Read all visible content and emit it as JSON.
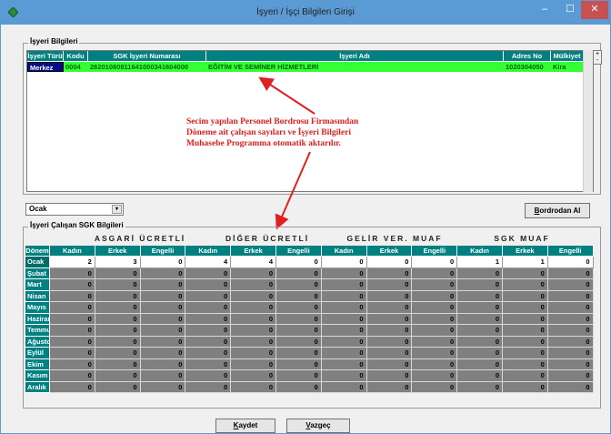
{
  "window": {
    "title": "İşyeri / İşçi Bilgileri Girişi",
    "minimize_label": "–",
    "maximize_label": "☐",
    "close_label": "✕"
  },
  "employer_group": {
    "label": "İşyeri Bilgileri",
    "columns": [
      "İşyeri Türü",
      "Kodu",
      "SGK İşyeri Numarası",
      "İşyeri Adı",
      "Adres No",
      "Mülkiyet"
    ],
    "row": {
      "type": "Merkez",
      "code": "0004",
      "sgk_no": "26201080811641000341604000",
      "name": "EĞİTİM VE SEMİNER HİZMETLERİ",
      "address_no": "1020304050",
      "ownership": "Kira"
    },
    "spin_up": "+",
    "spin_down": "-"
  },
  "annotation": {
    "line1": "Secim yapılan Personel Bordrosu Firmasından",
    "line2": "Döneme ait çalışan sayıları ve İşyeri Bilgileri",
    "line3": "Muhasebe Programma otomatik aktarılır."
  },
  "month_select": {
    "value": "Ocak",
    "arrow": "▾"
  },
  "bordrodan_button": {
    "first": "B",
    "rest": "ordrodan Al"
  },
  "sgk_group": {
    "label": "İşyeri Çalışan SGK Bilgileri",
    "categories": [
      "ASGARİ ÜCRETLİ",
      "DİĞER ÜCRETLİ",
      "GELİR VER. MUAF",
      "SGK MUAF"
    ],
    "period_header": "Dönem",
    "sub_headers": [
      "Kadın",
      "Erkek",
      "Engelli",
      "Kadın",
      "Erkek",
      "Engelli",
      "Kadın",
      "Erkek",
      "Engelli",
      "Kadın",
      "Erkek",
      "Engelli"
    ],
    "rows": [
      {
        "month": "Ocak",
        "values": [
          "2",
          "3",
          "0",
          "4",
          "4",
          "0",
          "0",
          "0",
          "0",
          "1",
          "1",
          "0"
        ]
      },
      {
        "month": "Şubat",
        "values": [
          "0",
          "0",
          "0",
          "0",
          "0",
          "0",
          "0",
          "0",
          "0",
          "0",
          "0",
          "0"
        ]
      },
      {
        "month": "Mart",
        "values": [
          "0",
          "0",
          "0",
          "0",
          "0",
          "0",
          "0",
          "0",
          "0",
          "0",
          "0",
          "0"
        ]
      },
      {
        "month": "Nisan",
        "values": [
          "0",
          "0",
          "0",
          "0",
          "0",
          "0",
          "0",
          "0",
          "0",
          "0",
          "0",
          "0"
        ]
      },
      {
        "month": "Mayıs",
        "values": [
          "0",
          "0",
          "0",
          "0",
          "0",
          "0",
          "0",
          "0",
          "0",
          "0",
          "0",
          "0"
        ]
      },
      {
        "month": "Haziran",
        "values": [
          "0",
          "0",
          "0",
          "0",
          "0",
          "0",
          "0",
          "0",
          "0",
          "0",
          "0",
          "0"
        ]
      },
      {
        "month": "Temmuz",
        "values": [
          "0",
          "0",
          "0",
          "0",
          "0",
          "0",
          "0",
          "0",
          "0",
          "0",
          "0",
          "0"
        ]
      },
      {
        "month": "Ağustos",
        "values": [
          "0",
          "0",
          "0",
          "0",
          "0",
          "0",
          "0",
          "0",
          "0",
          "0",
          "0",
          "0"
        ]
      },
      {
        "month": "Eylül",
        "values": [
          "0",
          "0",
          "0",
          "0",
          "0",
          "0",
          "0",
          "0",
          "0",
          "0",
          "0",
          "0"
        ]
      },
      {
        "month": "Ekim",
        "values": [
          "0",
          "0",
          "0",
          "0",
          "0",
          "0",
          "0",
          "0",
          "0",
          "0",
          "0",
          "0"
        ]
      },
      {
        "month": "Kasım",
        "values": [
          "0",
          "0",
          "0",
          "0",
          "0",
          "0",
          "0",
          "0",
          "0",
          "0",
          "0",
          "0"
        ]
      },
      {
        "month": "Aralık",
        "values": [
          "0",
          "0",
          "0",
          "0",
          "0",
          "0",
          "0",
          "0",
          "0",
          "0",
          "0",
          "0"
        ]
      }
    ]
  },
  "footer": {
    "save": {
      "first": "K",
      "rest": "aydet"
    },
    "cancel": {
      "first": "V",
      "rest": "azgeç"
    }
  },
  "colors": {
    "titlebar": "#5b9bd5",
    "header_teal": "#008080",
    "selected_row_green": "#33ff33",
    "annotation_red": "#e02020",
    "empty_cell_gray": "#808080"
  },
  "icons": {
    "app": "green-diamond-icon",
    "arrow": "red-annotation-arrow"
  }
}
